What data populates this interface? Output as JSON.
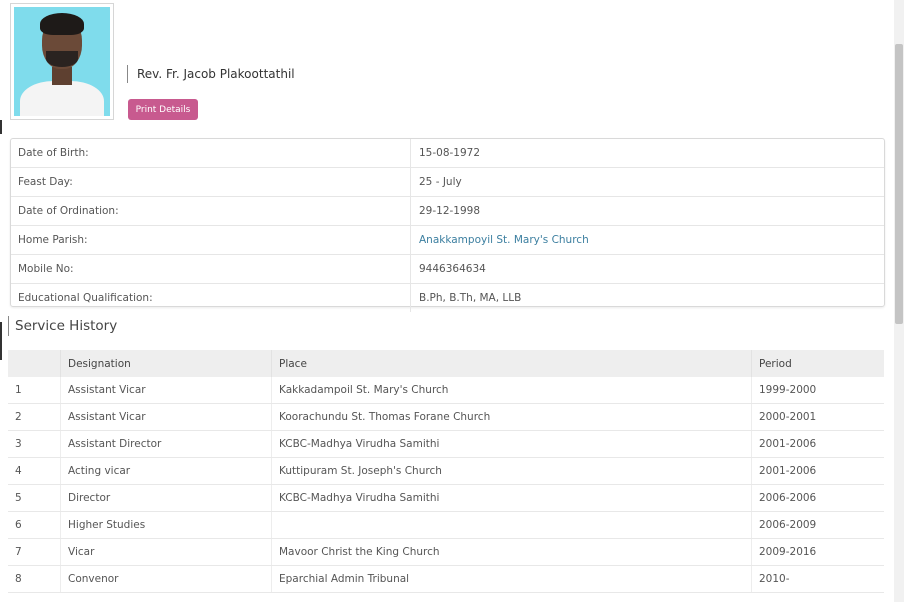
{
  "profile": {
    "name": "Rev. Fr. Jacob Plakoottathil",
    "print_label": "Print Details"
  },
  "details": [
    {
      "label": "Date of Birth:",
      "value": "15-08-1972"
    },
    {
      "label": "Feast Day:",
      "value": "25 - July"
    },
    {
      "label": "Date of Ordination:",
      "value": "29-12-1998"
    },
    {
      "label": "Home Parish:",
      "value": "Anakkampoyil St. Mary's Church"
    },
    {
      "label": "Mobile No:",
      "value": "9446364634"
    },
    {
      "label": "Educational Qualification:",
      "value": "B.Ph, B.Th, MA, LLB"
    }
  ],
  "service": {
    "title": "Service History",
    "headers": {
      "num": "",
      "designation": "Designation",
      "place": "Place",
      "period": "Period"
    },
    "rows": [
      {
        "num": "1",
        "designation": "Assistant Vicar",
        "place": "Kakkadampoil St. Mary's Church",
        "period": "1999-2000"
      },
      {
        "num": "2",
        "designation": "Assistant Vicar",
        "place": "Koorachundu St. Thomas Forane Church",
        "period": "2000-2001"
      },
      {
        "num": "3",
        "designation": "Assistant Director",
        "place": "KCBC-Madhya Virudha Samithi",
        "period": "2001-2006"
      },
      {
        "num": "4",
        "designation": "Acting vicar",
        "place": "Kuttipuram St. Joseph's Church",
        "period": "2001-2006"
      },
      {
        "num": "5",
        "designation": "Director",
        "place": "KCBC-Madhya Virudha Samithi",
        "period": "2006-2006"
      },
      {
        "num": "6",
        "designation": "Higher Studies",
        "place": "",
        "period": "2006-2009"
      },
      {
        "num": "7",
        "designation": "Vicar",
        "place": "Mavoor Christ the King Church",
        "period": "2009-2016"
      },
      {
        "num": "8",
        "designation": "Convenor",
        "place": "Eparchial Admin Tribunal",
        "period": "2010-"
      }
    ]
  }
}
